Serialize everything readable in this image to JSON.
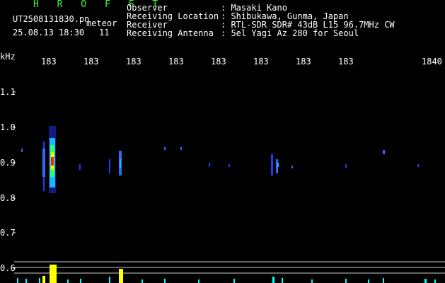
{
  "header": {
    "station": "H R O F F T",
    "filename": "UT2508131830.pn",
    "event_type": "meteor",
    "datetime": "25.08.13 18:30",
    "count": "11",
    "info": [
      {
        "label": "Observer",
        "value": ": Masaki Kano"
      },
      {
        "label": "Receiving Location",
        "value": ": Shibukawa, Gunma, Japan"
      },
      {
        "label": "Receiver",
        "value": ": RTL-SDR SDR# 43dB L15 96.7MHz CW"
      },
      {
        "label": "Receiving Antenna",
        "value": ": 5el Yagi Az 280 for Seoul"
      }
    ]
  },
  "axes": {
    "x_unit": "kHz",
    "x_ticks": [
      "183",
      "183",
      "183",
      "183",
      "183",
      "183",
      "183",
      "183",
      "1840"
    ],
    "y_ticks": [
      "1.1",
      "1.0",
      "0.9",
      "0.8",
      "0.7",
      "0.6"
    ]
  },
  "colors": {
    "background": "#000000",
    "text": "#ffffff",
    "title_green": "#33ff33",
    "trace_yellow": "#ffff00",
    "trace_cyan": "#00ffff",
    "hot_red": "#ff0000",
    "signal_blue": "#2a6bff"
  }
}
